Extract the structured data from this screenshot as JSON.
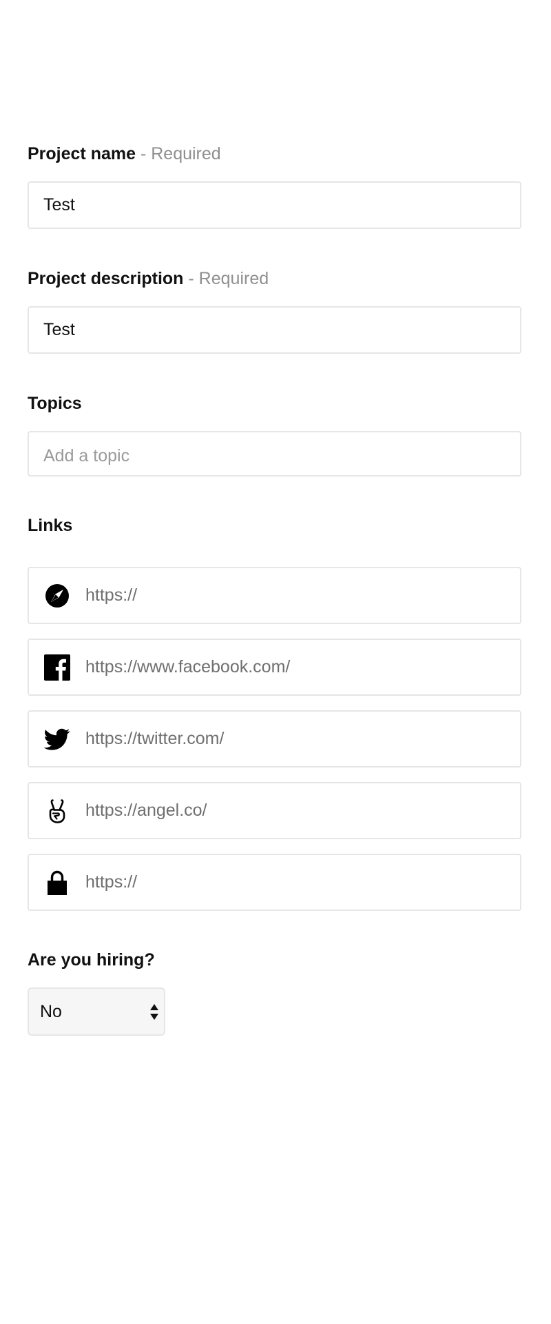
{
  "form": {
    "project_name": {
      "label": "Project name",
      "required_text": "- Required",
      "value": "Test"
    },
    "project_description": {
      "label": "Project description",
      "required_text": "- Required",
      "value": "Test"
    },
    "topics": {
      "label": "Topics",
      "placeholder": "Add a topic"
    },
    "links": {
      "label": "Links",
      "items": [
        {
          "icon": "compass-icon",
          "placeholder": "https://"
        },
        {
          "icon": "facebook-icon",
          "placeholder": "https://www.facebook.com/"
        },
        {
          "icon": "twitter-icon",
          "placeholder": "https://twitter.com/"
        },
        {
          "icon": "angellist-icon",
          "placeholder": "https://angel.co/"
        },
        {
          "icon": "lock-icon",
          "placeholder": "https://"
        }
      ]
    },
    "hiring": {
      "label": "Are you hiring?",
      "selected": "No"
    }
  }
}
